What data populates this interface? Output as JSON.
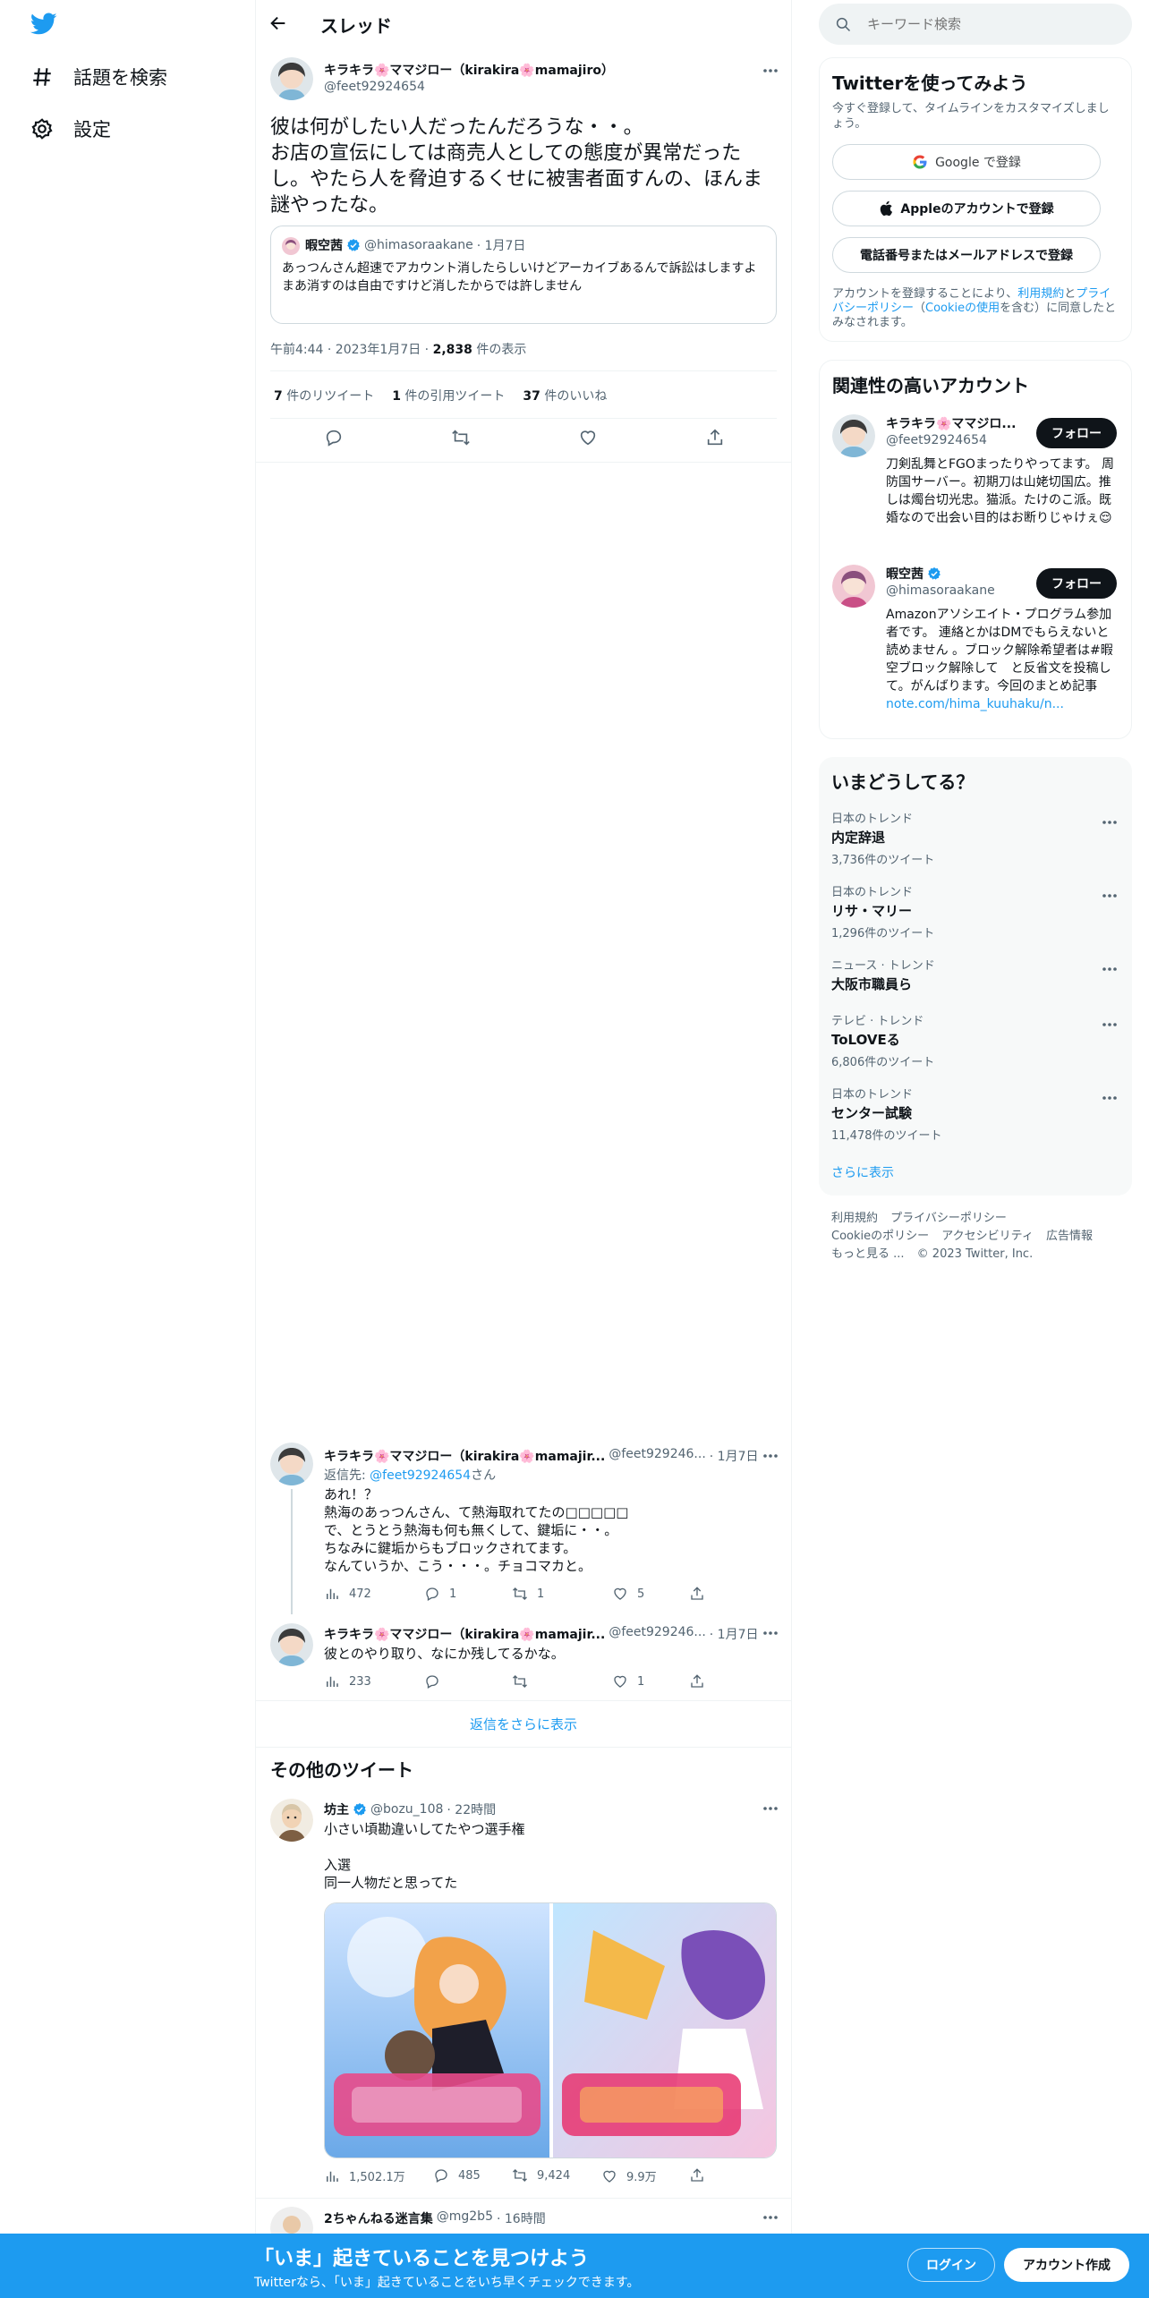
{
  "colors": {
    "brand": "#1d9bf0",
    "text": "#0f1419",
    "muted": "#536471"
  },
  "nav": {
    "explore_label": "話題を検索",
    "settings_label": "設定"
  },
  "header": {
    "title": "スレッド"
  },
  "main_tweet": {
    "author_name": "キラキラ🌸ママジロー（kirakira🌸mamajiro）",
    "author_handle": "@feet92924654",
    "text": "彼は何がしたい人だったんだろうな・・。\nお店の宣伝にしては商売人としての態度が異常だったし。やたら人を脅迫するくせに被害者面すんの、ほんま謎やったな。",
    "quote": {
      "author_name": "暇空茜",
      "author_handle": "@himasoraakane",
      "date": "· 1月7日",
      "text": "あっつんさん超速でアカウント消したらしいけどアーカイブあるんで訴訟はしますよ\nまあ消すのは自由ですけど消したからでは許しません"
    },
    "meta_time": "午前4:44 · 2023年1月7日 · ",
    "meta_views_num": "2,838",
    "meta_views_label": " 件の表示",
    "retweets_num": "7",
    "retweets_label": " 件のリツイート",
    "quotes_num": "1",
    "quotes_label": " 件の引用ツイート",
    "likes_num": "37",
    "likes_label": " 件のいいね"
  },
  "replies": [
    {
      "author_name": "キラキラ🌸ママジロー（kirakira🌸mamajir...",
      "author_handle": "@feet929246...",
      "date": "· 1月7日",
      "reply_to_prefix": "返信先: ",
      "reply_to_handle": "@feet92924654",
      "reply_to_suffix": "さん",
      "text": "あれ！？\n熱海のあっつんさん、て熱海取れてたの□□□□□\nで、とうとう熱海も何も無くして、鍵垢に・・。\nちなみに鍵垢からもブロックされてます。\nなんていうか、こう・・・。チョコマカと。",
      "views": "472",
      "replies": "1",
      "retweets": "1",
      "likes": "5"
    },
    {
      "author_name": "キラキラ🌸ママジロー（kirakira🌸mamajir...",
      "author_handle": "@feet929246...",
      "date": "· 1月7日",
      "text": "彼とのやり取り、なにか残してるかな。",
      "views": "233",
      "replies": "",
      "retweets": "",
      "likes": "1"
    }
  ],
  "show_more_replies": "返信をさらに表示",
  "more_tweets": {
    "heading": "その他のツイート",
    "tweet": {
      "author_name": "坊主",
      "author_handle": "@bozu_108",
      "date": "· 22時間",
      "text": "小さい頃勘違いしてたやつ選手権\n\n入選\n同一人物だと思ってた",
      "views": "1,502.1万",
      "replies": "485",
      "retweets": "9,424",
      "likes": "9.9万"
    },
    "next_author_name": "2ちゃんねる迷言集",
    "next_author_handle": "@mg2b5",
    "next_date": "· 16時間"
  },
  "search": {
    "placeholder": "キーワード検索"
  },
  "signup": {
    "title": "Twitterを使ってみよう",
    "subtitle": "今すぐ登録して、タイムラインをカスタマイズしましょう。",
    "google": "Google で登録",
    "apple": "Appleのアカウントで登録",
    "phone": "電話番号またはメールアドレスで登録",
    "legal_1": "アカウントを登録することにより、",
    "legal_terms": "利用規約",
    "legal_2": "と",
    "legal_privacy": "プライバシーポリシー",
    "legal_3": "（",
    "legal_cookie": "Cookieの使用",
    "legal_4": "を含む）に同意したとみなされます。"
  },
  "related": {
    "title": "関連性の高いアカウント",
    "follow_label": "フォロー",
    "accounts": [
      {
        "name": "キラキラ🌸ママジロ...",
        "handle": "@feet92924654",
        "bio": "刀剣乱舞とFGOまったりやってます。 周防国サーバー。初期刀は山姥切国広。推しは燭台切光忠。猫派。たけのこ派。既婚なので出会い目的はお断りじゃけぇ😌"
      },
      {
        "name": "暇空茜",
        "handle": "@himasoraakane",
        "bio": "Amazonアソシエイト・プログラム参加者です。 連絡とかはDMでもらえないと読めません 。ブロック解除希望者は#暇空ブロック解除して　と反省文を投稿して。がんばります。今回のまとめ記事",
        "bio_link": "note.com/hima_kuuhaku/n..."
      }
    ]
  },
  "trends": {
    "title": "いまどうしてる？",
    "items": [
      {
        "context": "日本のトレンド",
        "name": "内定辞退",
        "count": "3,736件のツイート"
      },
      {
        "context": "日本のトレンド",
        "name": "リサ・マリー",
        "count": "1,296件のツイート"
      },
      {
        "context": "ニュース · トレンド",
        "name": "大阪市職員ら",
        "count": ""
      },
      {
        "context": "テレビ · トレンド",
        "name": "ToLOVEる",
        "count": "6,806件のツイート"
      },
      {
        "context": "日本のトレンド",
        "name": "センター試験",
        "count": "11,478件のツイート"
      }
    ],
    "show_more": "さらに表示"
  },
  "footer": {
    "links_row1": [
      "利用規約",
      "プライバシーポリシー"
    ],
    "links_row2": [
      "Cookieのポリシー",
      "アクセシビリティ",
      "広告情報"
    ],
    "more": "もっと見る ...",
    "copyright": "© 2023 Twitter, Inc."
  },
  "bottom_bar": {
    "title": "「いま」起きていることを見つけよう",
    "subtitle": "Twitterなら、「いま」起きていることをいち早くチェックできます。",
    "login": "ログイン",
    "signup": "アカウント作成"
  }
}
